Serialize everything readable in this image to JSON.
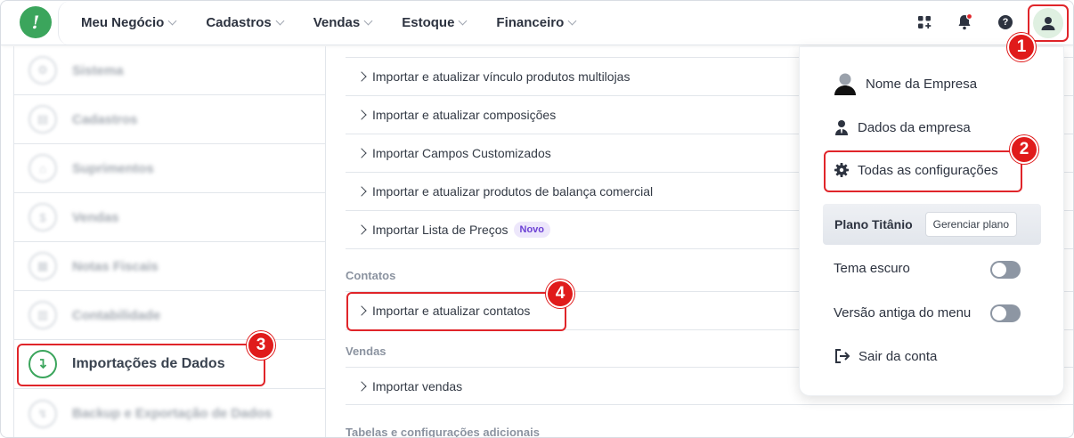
{
  "nav": {
    "items": [
      {
        "label": "Meu Negócio"
      },
      {
        "label": "Cadastros"
      },
      {
        "label": "Vendas"
      },
      {
        "label": "Estoque"
      },
      {
        "label": "Financeiro"
      }
    ]
  },
  "header_icons": [
    "apps-grid-icon",
    "bell-icon",
    "help-icon",
    "user-avatar-icon"
  ],
  "sidebar": {
    "items": [
      {
        "label": "Sistema",
        "icon": "system-icon"
      },
      {
        "label": "Cadastros",
        "icon": "registry-icon"
      },
      {
        "label": "Suprimentos",
        "icon": "supplies-icon"
      },
      {
        "label": "Vendas",
        "icon": "sales-icon"
      },
      {
        "label": "Notas Fiscais",
        "icon": "invoice-icon"
      },
      {
        "label": "Contabilidade",
        "icon": "accounting-icon"
      },
      {
        "label": "Importações de Dados",
        "icon": "import-arrow-icon"
      },
      {
        "label": "Backup e Exportação de Dados",
        "icon": "backup-icon"
      }
    ],
    "active_index": 6
  },
  "main": {
    "rows_top": [
      {
        "label": "Importar e atualizar vínculo produtos multilojas"
      },
      {
        "label": "Importar e atualizar composições"
      },
      {
        "label": "Importar Campos Customizados"
      },
      {
        "label": "Importar e atualizar produtos de balança comercial"
      },
      {
        "label": "Importar Lista de Preços",
        "pill": "Novo"
      }
    ],
    "section_contatos": "Contatos",
    "row_contatos": "Importar e atualizar contatos",
    "section_vendas": "Vendas",
    "row_vendas": "Importar vendas",
    "section_tabelas": "Tabelas e configurações adicionais"
  },
  "dropdown": {
    "company_name": "Nome da Empresa",
    "company_data": "Dados da empresa",
    "all_settings": "Todas as configurações",
    "plan_label": "Plano Titânio",
    "plan_button": "Gerenciar plano",
    "dark_theme": "Tema escuro",
    "old_menu": "Versão antiga do menu",
    "logout": "Sair da conta",
    "dark_theme_on": false,
    "old_menu_on": false
  },
  "badges": [
    "1",
    "2",
    "3",
    "4"
  ],
  "colors": {
    "brand_green": "#3ba55c",
    "highlight_red": "#e0252a",
    "new_pill_purple": "#6b3fd4"
  }
}
